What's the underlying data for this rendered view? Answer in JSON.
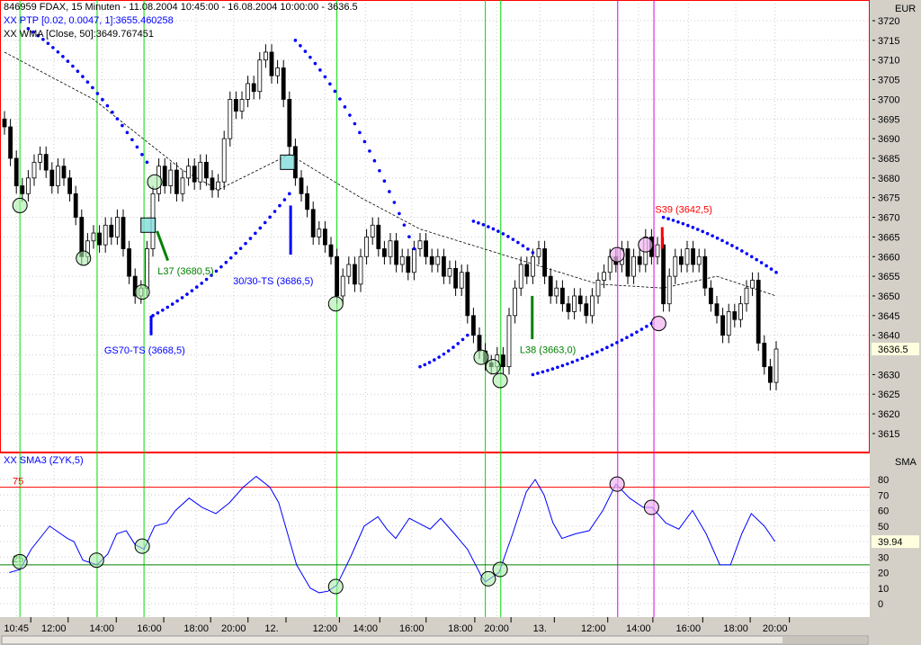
{
  "header": {
    "title": "846959  FDAX, 15 Minuten - 11.08.2004 10:45:00 - 16.08.2004 10:00:00 - 3636.5",
    "ptp": "XX PTP [0.02, 0.0047, 1]:3655.460258",
    "wma": "XX WMA [Close, 50]:3649.767451"
  },
  "osc_header": "XX   SMA3 (ZYK,5)",
  "colors": {
    "candle_up": "#ffffff",
    "candle_down": "#000000",
    "sar": "#0000ff",
    "osc": "#0000ff",
    "vline_green": "#00dd00",
    "vline_magenta": "#dd00dd",
    "border": "#ff0000",
    "axis_bg": "#d4d0c8"
  },
  "chart_data": [
    {
      "type": "candlestick",
      "title": "FDAX, 15 Minuten",
      "ylabel": "EUR",
      "ylim": [
        3612,
        3722
      ],
      "yticks": [
        3720,
        3715,
        3710,
        3705,
        3700,
        3695,
        3690,
        3685,
        3680,
        3675,
        3670,
        3665,
        3660,
        3655,
        3650,
        3645,
        3640,
        3630,
        3625,
        3620,
        3615
      ],
      "last_price": "3636.5",
      "first_open": 3695,
      "closes": [
        3693,
        3685,
        3678,
        3676,
        3680,
        3684,
        3686,
        3682,
        3678,
        3683,
        3680,
        3676,
        3670,
        3660,
        3664,
        3666,
        3663,
        3668,
        3665,
        3670,
        3662,
        3655,
        3650,
        3652,
        3662,
        3676,
        3683,
        3678,
        3682,
        3676,
        3680,
        3683,
        3679,
        3684,
        3680,
        3677,
        3679,
        3690,
        3700,
        3697,
        3700,
        3704,
        3702,
        3710,
        3712,
        3706,
        3708,
        3700,
        3688,
        3680,
        3676,
        3672,
        3665,
        3667,
        3663,
        3660,
        3650,
        3655,
        3658,
        3653,
        3660,
        3665,
        3668,
        3662,
        3660,
        3664,
        3658,
        3660,
        3656,
        3662,
        3664,
        3660,
        3658,
        3660,
        3655,
        3657,
        3652,
        3656,
        3645,
        3640,
        3636,
        3633,
        3632,
        3635,
        3632,
        3645,
        3652,
        3658,
        3655,
        3660,
        3662,
        3655,
        3650,
        3652,
        3648,
        3646,
        3650,
        3648,
        3645,
        3650,
        3654,
        3656,
        3660,
        3658,
        3662,
        3655,
        3660,
        3658,
        3665,
        3660,
        3663,
        3648,
        3655,
        3660,
        3658,
        3662,
        3658,
        3660,
        3652,
        3648,
        3645,
        3640,
        3646,
        3644,
        3648,
        3652,
        3654,
        3638,
        3632,
        3628,
        3636.5
      ],
      "wma": [
        [
          0,
          3712
        ],
        [
          15,
          3700
        ],
        [
          30,
          3682
        ],
        [
          36,
          3677
        ],
        [
          48,
          3686
        ],
        [
          60,
          3675
        ],
        [
          70,
          3667
        ],
        [
          85,
          3660
        ],
        [
          100,
          3653
        ],
        [
          111,
          3652
        ],
        [
          120,
          3655
        ],
        [
          130,
          3650
        ]
      ],
      "sar_segments": [
        {
          "from": [
            4,
            3718
          ],
          "to": [
            24,
            3684
          ]
        },
        {
          "from": [
            25,
            3645
          ],
          "to": [
            48,
            3676
          ]
        },
        {
          "from": [
            49,
            3715
          ],
          "to": [
            69,
            3662
          ]
        },
        {
          "from": [
            70,
            3632
          ],
          "to": [
            78,
            3640
          ]
        },
        {
          "from": [
            79,
            3669
          ],
          "to": [
            89,
            3661
          ]
        },
        {
          "from": [
            89,
            3630
          ],
          "to": [
            109,
            3643
          ]
        },
        {
          "from": [
            111,
            3670
          ],
          "to": [
            130,
            3656
          ]
        }
      ],
      "vlines": [
        {
          "bar": 2.6,
          "color": "green"
        },
        {
          "bar": 15.6,
          "color": "green"
        },
        {
          "bar": 23.5,
          "color": "green"
        },
        {
          "bar": 56,
          "color": "green"
        },
        {
          "bar": 81,
          "color": "green"
        },
        {
          "bar": 83.6,
          "color": "green"
        },
        {
          "bar": 103.3,
          "color": "magenta"
        },
        {
          "bar": 109.4,
          "color": "magenta"
        }
      ],
      "markers": [
        {
          "bar": 2.6,
          "price": 3673,
          "kind": "green"
        },
        {
          "bar": 13.3,
          "price": 3659.6,
          "kind": "green"
        },
        {
          "bar": 23.2,
          "price": 3651,
          "kind": "green"
        },
        {
          "bar": 25.3,
          "price": 3679,
          "kind": "green"
        },
        {
          "bar": 55.8,
          "price": 3648,
          "kind": "green"
        },
        {
          "bar": 80.3,
          "price": 3634.4,
          "kind": "green"
        },
        {
          "bar": 82.3,
          "price": 3632,
          "kind": "green"
        },
        {
          "bar": 83.5,
          "price": 3628.5,
          "kind": "green"
        },
        {
          "bar": 103.2,
          "price": 3660.5,
          "kind": "pink"
        },
        {
          "bar": 108,
          "price": 3663,
          "kind": "pink"
        },
        {
          "bar": 110.2,
          "price": 3643,
          "kind": "pink"
        }
      ],
      "squares": [
        {
          "bar": 24.2,
          "price": 3668
        },
        {
          "bar": 47.7,
          "price": 3684
        }
      ],
      "signals": [
        {
          "label": "L37 (3680,5)",
          "color": "#008000",
          "bar": 25.7,
          "p1": 3666.5,
          "p2": 3659,
          "slant": true,
          "text_bar": 25.8,
          "text_price": 3655.5
        },
        {
          "label": "30/30-TS (3686,5)",
          "color": "#0000ff",
          "bar": 48.2,
          "p1": 3673,
          "p2": 3660.5,
          "slant": false,
          "text_bar": 38.5,
          "text_price": 3653
        },
        {
          "label": "GS70-TS (3668,5)",
          "color": "#0000ff",
          "bar": 24.7,
          "p1": 3645,
          "p2": 3640,
          "slant": false,
          "text_bar": 16.8,
          "text_price": 3635.3
        },
        {
          "label": "L38 (3663,0)",
          "color": "#008000",
          "bar": 88.9,
          "p1": 3650,
          "p2": 3639,
          "slant": false,
          "text_bar": 86.8,
          "text_price": 3635.5
        },
        {
          "label": "S39 (3642,5)",
          "color": "#ff0000",
          "bar": 110.8,
          "p1": 3667.5,
          "p2": 3662,
          "slant": false,
          "text_bar": 109.6,
          "text_price": 3671.2
        }
      ]
    },
    {
      "type": "line",
      "title": "SMA3 (ZYK,5)",
      "ylabel": "SMA",
      "ylim": [
        -10,
        85
      ],
      "yticks": [
        80,
        70,
        60,
        50,
        30,
        20,
        10,
        0
      ],
      "last_value": "39.94",
      "levels": [
        {
          "value": 75,
          "label": "75",
          "color": "#ff0000"
        },
        {
          "value": 25,
          "label": "25",
          "color": "#008000"
        }
      ],
      "points": [
        [
          0.8,
          20
        ],
        [
          2.6,
          22
        ],
        [
          4.5,
          35
        ],
        [
          7.6,
          50
        ],
        [
          10.6,
          42
        ],
        [
          11.7,
          40
        ],
        [
          13.2,
          28
        ],
        [
          15.6,
          25
        ],
        [
          17.4,
          32
        ],
        [
          18.9,
          45
        ],
        [
          20.5,
          47
        ],
        [
          22,
          38
        ],
        [
          23.5,
          35
        ],
        [
          25.3,
          50
        ],
        [
          27.3,
          52
        ],
        [
          28.8,
          60
        ],
        [
          31.1,
          68
        ],
        [
          33.3,
          62
        ],
        [
          35.6,
          58
        ],
        [
          37.9,
          65
        ],
        [
          40.2,
          75
        ],
        [
          42.4,
          82
        ],
        [
          44.7,
          75
        ],
        [
          46.2,
          65
        ],
        [
          47.7,
          45
        ],
        [
          49.2,
          25
        ],
        [
          51.5,
          10
        ],
        [
          53,
          7
        ],
        [
          54.5,
          8
        ],
        [
          56,
          12
        ],
        [
          58.3,
          30
        ],
        [
          60.6,
          50
        ],
        [
          62.9,
          56
        ],
        [
          64.4,
          48
        ],
        [
          65.9,
          42
        ],
        [
          68.2,
          55
        ],
        [
          69.7,
          52
        ],
        [
          71.7,
          48
        ],
        [
          73.5,
          55
        ],
        [
          75.8,
          45
        ],
        [
          78,
          35
        ],
        [
          80.3,
          18
        ],
        [
          81,
          14
        ],
        [
          83.3,
          20
        ],
        [
          85.6,
          45
        ],
        [
          87.9,
          72
        ],
        [
          89.4,
          80
        ],
        [
          90.9,
          70
        ],
        [
          92.4,
          52
        ],
        [
          93.9,
          42
        ],
        [
          96.2,
          45
        ],
        [
          98.5,
          47
        ],
        [
          100.8,
          60
        ],
        [
          103,
          77
        ],
        [
          105.3,
          68
        ],
        [
          107.6,
          62
        ],
        [
          109.1,
          62
        ],
        [
          111.4,
          52
        ],
        [
          113.6,
          48
        ],
        [
          115.9,
          60
        ],
        [
          118.2,
          45
        ],
        [
          120.5,
          25
        ],
        [
          122.3,
          25
        ],
        [
          124.2,
          45
        ],
        [
          125.8,
          58
        ],
        [
          128,
          50
        ],
        [
          129.8,
          40
        ]
      ],
      "markers": [
        {
          "bar": 2.6,
          "value": 27,
          "kind": "green"
        },
        {
          "bar": 15.5,
          "value": 28,
          "kind": "green"
        },
        {
          "bar": 23.2,
          "value": 37,
          "kind": "green"
        },
        {
          "bar": 55.8,
          "value": 11,
          "kind": "green"
        },
        {
          "bar": 81.5,
          "value": 16,
          "kind": "green"
        },
        {
          "bar": 83.5,
          "value": 22,
          "kind": "green"
        },
        {
          "bar": 103.2,
          "value": 77,
          "kind": "pink"
        },
        {
          "bar": 109,
          "value": 62,
          "kind": "pink"
        }
      ]
    }
  ],
  "time_axis": [
    {
      "label": "10:45",
      "bar": 2
    },
    {
      "label": "12:00",
      "bar": 8.3
    },
    {
      "label": "14:00",
      "bar": 16.4
    },
    {
      "label": "16:00",
      "bar": 24.4
    },
    {
      "label": "18:00",
      "bar": 32.3
    },
    {
      "label": "20:00",
      "bar": 38.6
    },
    {
      "label": "12.",
      "bar": 45
    },
    {
      "label": "12:00",
      "bar": 54
    },
    {
      "label": "14:00",
      "bar": 60.8
    },
    {
      "label": "16:00",
      "bar": 68.6
    },
    {
      "label": "18:00",
      "bar": 76.8
    },
    {
      "label": "20:00",
      "bar": 82.9
    },
    {
      "label": "13.",
      "bar": 90.2
    },
    {
      "label": "12:00",
      "bar": 99.2
    },
    {
      "label": "14:00",
      "bar": 106.8
    },
    {
      "label": "16:00",
      "bar": 115.2
    },
    {
      "label": "18:00",
      "bar": 123.2
    },
    {
      "label": "20:00",
      "bar": 129.8
    }
  ]
}
